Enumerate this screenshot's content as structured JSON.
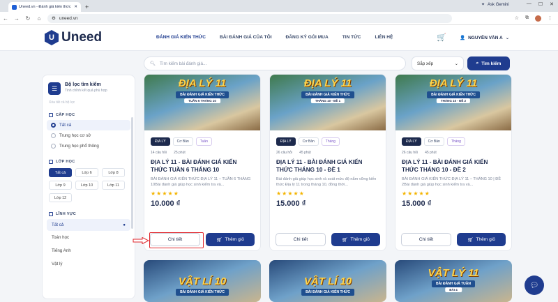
{
  "browser": {
    "tab_title": "Uneed.vn - Đánh giá kiến thức",
    "url": "uneed.vn",
    "gemini": "Ask Gemini"
  },
  "site": {
    "logo_letter": "U",
    "logo": "Uneed",
    "menu": [
      "ĐÁNH GIÁ KIẾN THỨC",
      "BÀI ĐÁNH GIÁ CỦA TÔI",
      "ĐĂNG KÝ GÓI MUA",
      "TIN TỨC",
      "LIÊN HỆ"
    ],
    "user": "NGUYỄN VĂN A"
  },
  "search": {
    "placeholder": "Tìm kiếm bài đánh giá...",
    "sort": "Sắp xếp",
    "button": "Tìm kiếm"
  },
  "filter": {
    "title": "Bộ lọc tìm kiếm",
    "subtitle": "Tinh chỉnh kết quả phù hợp",
    "clear": "Xóa tất cả bộ lọc",
    "level_title": "CẤP HỌC",
    "levels": [
      "Tất cả",
      "Trung học cơ sở",
      "Trung học phổ thông"
    ],
    "grade_title": "LỚP HỌC",
    "grades": [
      "Tất cả",
      "Lớp 6",
      "Lớp 8",
      "Lớp 9",
      "Lớp 10",
      "Lớp 11",
      "Lớp 12"
    ],
    "field_title": "LĨNH VỰC",
    "fields": [
      "Tất cả",
      "Toán học",
      "Tiếng Anh",
      "Vật lý"
    ]
  },
  "cards": [
    {
      "thumb_title": "ĐỊA LÝ 11",
      "thumb_banner": "BÀI ĐÁNH GIÁ KIẾN THỨC",
      "thumb_tag": "TUẦN 6 THÁNG 10",
      "subject": "ĐỊA LÝ",
      "level": "Cơ Bản",
      "period": "Tuần",
      "questions": "14 câu hỏi",
      "duration": "25 phút",
      "title": "ĐỊA LÝ 11 - BÀI ĐÁNH GIÁ KIẾN THỨC TUẦN 6 THÁNG 10",
      "desc": "BÀI ĐÁNH GIÁ KIẾN THỨC ĐỊA LÝ 11 – TUẦN 6 THÁNG 10Bài đánh giá giúp học sinh kiểm tra và...",
      "stars": "★★★★★",
      "price": "10.000 ₫",
      "detail": "Chi tiết",
      "add": "Thêm giỏ"
    },
    {
      "thumb_title": "ĐỊA LÝ 11",
      "thumb_banner": "BÀI ĐÁNH GIÁ KIẾN THỨC",
      "thumb_tag": "THÁNG 10 - ĐỀ 1",
      "subject": "ĐỊA LÝ",
      "level": "Cơ Bản",
      "period": "Tháng",
      "questions": "26 câu hỏi",
      "duration": "45 phút",
      "title": "ĐỊA LÝ 11 - BÀI ĐÁNH GIÁ KIẾN THỨC THÁNG 10 - ĐỀ 1",
      "desc": "Bài đánh giá giúp học sinh rà soát mức độ nắm vững kiến thức Địa lý 11 trong tháng 10, đồng thời...",
      "stars": "★★★★★",
      "price": "15.000 ₫",
      "detail": "Chi tiết",
      "add": "Thêm giỏ"
    },
    {
      "thumb_title": "ĐỊA LÝ 11",
      "thumb_banner": "BÀI ĐÁNH GIÁ KIẾN THỨC",
      "thumb_tag": "THÁNG 10 - ĐỀ 2",
      "subject": "ĐỊA LÝ",
      "level": "Cơ Bản",
      "period": "Tháng",
      "questions": "26 câu hỏi",
      "duration": "45 phút",
      "title": "ĐỊA LÝ 11 - BÀI ĐÁNH GIÁ KIẾN THỨC THÁNG 10 - ĐỀ 2",
      "desc": "BÀI ĐÁNH GIÁ KIẾN THỨC ĐỊA LÝ 11 – THÁNG 10 | ĐỀ 2Bài đánh giá giúp học sinh kiểm tra và...",
      "stars": "★★★★★",
      "price": "15.000 ₫",
      "detail": "Chi tiết",
      "add": "Thêm giỏ"
    }
  ],
  "cards_row2": [
    {
      "title": "VẬT LÍ 10",
      "banner": "BÀI ĐÁNH GIÁ KIẾN THỨC",
      "tag": ""
    },
    {
      "title": "VẬT LÍ 10",
      "banner": "BÀI ĐÁNH GIÁ KIẾN THỨC",
      "tag": ""
    },
    {
      "title": "VẬT LÝ 11",
      "banner": "BÀI ĐÁNH GIÁ TUẦN",
      "tag": "BÀI 4"
    }
  ],
  "colors": {
    "primary": "#1f3c8f",
    "highlight": "#e0252b",
    "star": "#f4b400"
  }
}
